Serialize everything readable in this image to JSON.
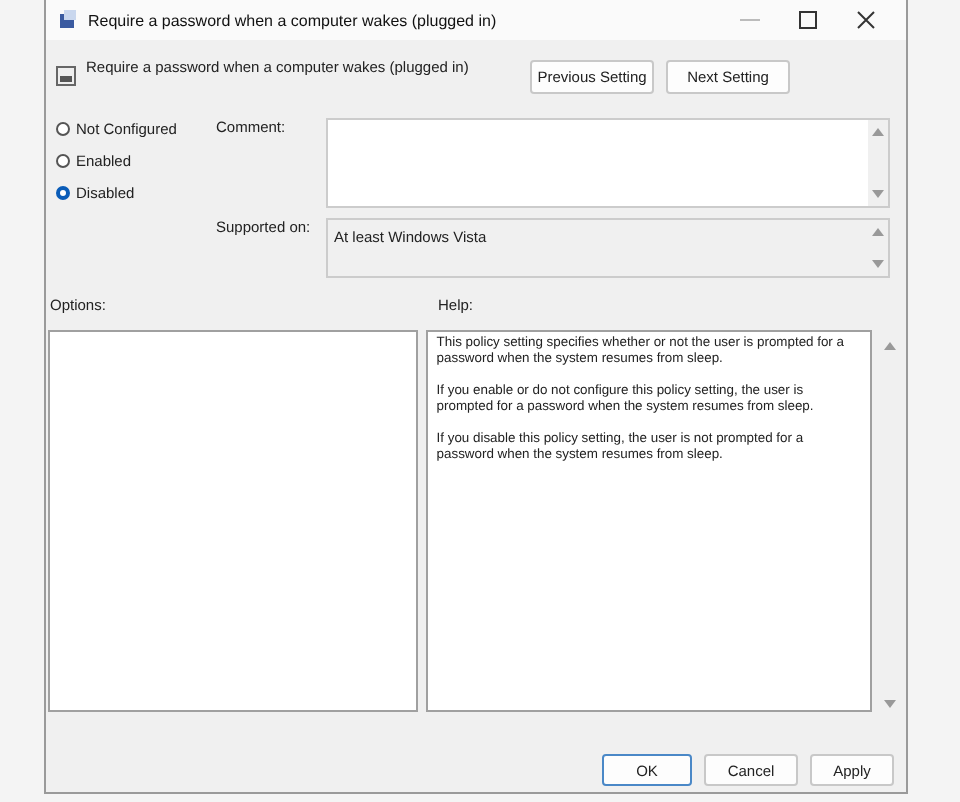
{
  "window": {
    "title": "Require a password when a computer wakes (plugged in)"
  },
  "header": {
    "title": "Require a password when a computer wakes (plugged in)",
    "buttons": [
      "Previous Setting",
      "Next Setting"
    ]
  },
  "states": [
    {
      "label": "Not Configured",
      "selected": false
    },
    {
      "label": "Enabled",
      "selected": false
    },
    {
      "label": "Disabled",
      "selected": true
    }
  ],
  "comment": {
    "label": "Comment:"
  },
  "supported_on": {
    "label": "Supported on:",
    "value": "At least Windows Vista"
  },
  "options": {
    "label": "Options:"
  },
  "help": {
    "label": "Help:",
    "paragraphs": [
      "This policy setting specifies whether or not the user is prompted for a password when the system resumes from sleep.",
      "If you enable or do not configure this policy setting, the user is prompted for a password when the system resumes from sleep.",
      "If you disable this policy setting, the user is not prompted for a password when the system resumes from sleep."
    ]
  },
  "buttons": [
    {
      "label": "OK",
      "default": true
    },
    {
      "label": "Cancel",
      "default": false
    },
    {
      "label": "Apply",
      "default": false
    }
  ]
}
